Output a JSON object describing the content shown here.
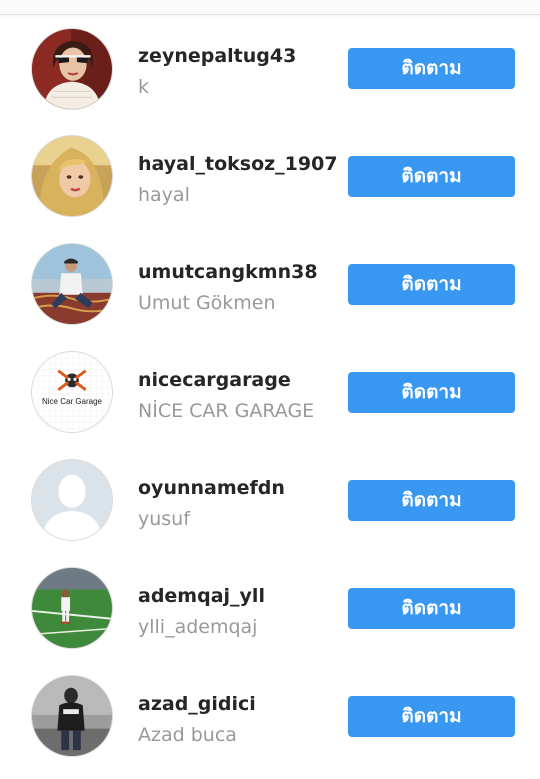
{
  "accent_color": "#3897f0",
  "users": [
    {
      "username": "zeynepaltug43",
      "fullname": "k",
      "button": "ติดตาม",
      "avatar_icon": "profile-photo-woman-sunglasses"
    },
    {
      "username": "hayal_toksoz_1907",
      "fullname": "hayal",
      "button": "ติดตาม",
      "avatar_icon": "profile-photo-woman-blonde"
    },
    {
      "username": "umutcangkmn38",
      "fullname": "Umut Gökmen",
      "button": "ติดตาม",
      "avatar_icon": "profile-photo-man-sitting"
    },
    {
      "username": "nicecargarage",
      "fullname": "NİCE CAR GARAGE",
      "button": "ติดตาม",
      "avatar_icon": "nice-car-garage-logo",
      "logo_text": "Nice Car Garage"
    },
    {
      "username": "oyunnamefdn",
      "fullname": "yusuf",
      "button": "ติดตาม",
      "avatar_icon": "default-avatar-silhouette"
    },
    {
      "username": "ademqaj_yll",
      "fullname": "ylli_ademqaj",
      "button": "ติดตาม",
      "avatar_icon": "profile-photo-child-football-field"
    },
    {
      "username": "azad_gidici",
      "fullname": "Azad buca",
      "button": "ติดตาม",
      "avatar_icon": "profile-photo-man-dark-hoodie"
    }
  ]
}
